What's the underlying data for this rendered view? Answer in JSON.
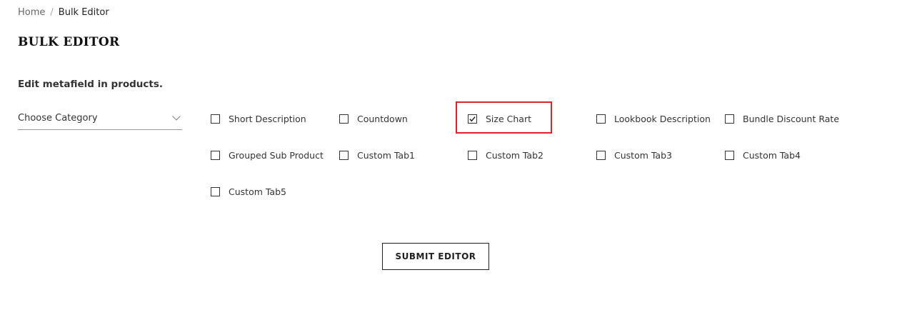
{
  "breadcrumb": {
    "home": "Home",
    "separator": "/",
    "current": "Bulk Editor"
  },
  "page": {
    "title": "BULK EDITOR",
    "subtitle": "Edit metafield in products."
  },
  "category_select": {
    "label": "Choose Category",
    "icon": "chevron-down-icon"
  },
  "options": [
    {
      "label": "Short Description",
      "checked": false
    },
    {
      "label": "Countdown",
      "checked": false
    },
    {
      "label": "Size Chart",
      "checked": true
    },
    {
      "label": "Lookbook Description",
      "checked": false
    },
    {
      "label": "Bundle Discount Rate",
      "checked": false
    },
    {
      "label": "Grouped Sub Product",
      "checked": false
    },
    {
      "label": "Custom Tab1",
      "checked": false
    },
    {
      "label": "Custom Tab2",
      "checked": false
    },
    {
      "label": "Custom Tab3",
      "checked": false
    },
    {
      "label": "Custom Tab4",
      "checked": false
    },
    {
      "label": "Custom Tab5",
      "checked": false
    }
  ],
  "submit": {
    "label": "SUBMIT EDITOR"
  },
  "colors": {
    "highlight": "#d6262c",
    "text": "#333333"
  }
}
